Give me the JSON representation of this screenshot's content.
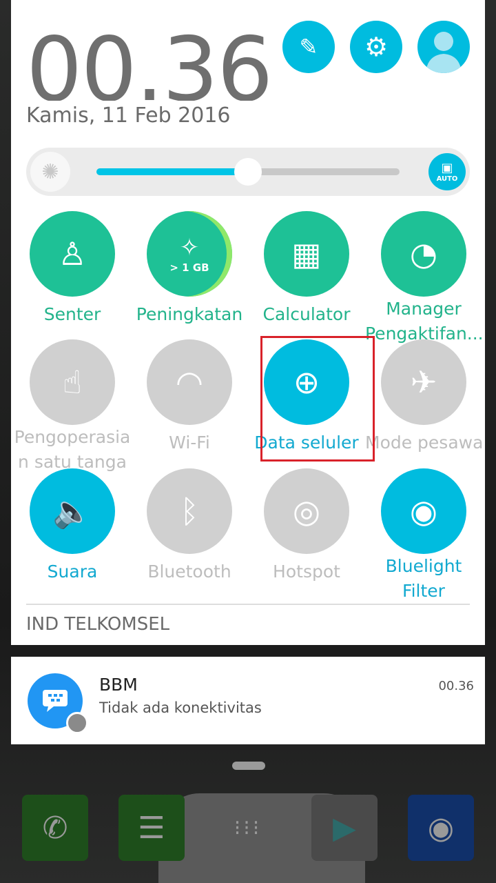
{
  "clock": {
    "time": "00.36",
    "date": "Kamis, 11 Feb 2016"
  },
  "header_buttons": [
    {
      "name": "edit-icon"
    },
    {
      "name": "gear-icon"
    },
    {
      "name": "user-avatar-icon"
    }
  ],
  "brightness": {
    "level_percent": 50,
    "auto_label": "AUTO"
  },
  "tiles": [
    {
      "label": "Senter",
      "state": "on",
      "icon": "flashlight-icon",
      "color": "#1ec196"
    },
    {
      "label": "Peningkatan",
      "badge": "> 1 GB",
      "state": "on",
      "icon": "broom-icon",
      "color": "#1ec196"
    },
    {
      "label": "Calculator",
      "state": "on",
      "icon": "calculator-icon",
      "color": "#1ec196"
    },
    {
      "label": "Manager Pengaktifan...",
      "state": "on",
      "icon": "gauge-wrench-icon",
      "color": "#1ec196"
    },
    {
      "label": "Pengoperasian satu tangan",
      "state": "off",
      "icon": "one-hand-icon",
      "color": "#d0d0d0"
    },
    {
      "label": "Wi-Fi",
      "state": "off",
      "icon": "wifi-icon",
      "color": "#d0d0d0"
    },
    {
      "label": "Data seluler",
      "state": "on",
      "icon": "globe-phone-icon",
      "color": "#00bcdf",
      "highlighted": true
    },
    {
      "label": "Mode pesawat",
      "state": "off",
      "icon": "airplane-icon",
      "color": "#d0d0d0"
    },
    {
      "label": "Suara",
      "state": "on",
      "icon": "speaker-icon",
      "color": "#00bcdf"
    },
    {
      "label": "Bluetooth",
      "state": "off",
      "icon": "bluetooth-icon",
      "color": "#d0d0d0"
    },
    {
      "label": "Hotspot",
      "state": "off",
      "icon": "hotspot-icon",
      "color": "#d0d0d0"
    },
    {
      "label": "Bluelight Filter",
      "state": "on",
      "icon": "eye-shield-icon",
      "color": "#00bcdf"
    }
  ],
  "carrier": "IND TELKOMSEL",
  "notification": {
    "app": "BBM",
    "text": "Tidak ada konektivitas",
    "time": "00.36"
  },
  "dock": [
    {
      "name": "phone-icon"
    },
    {
      "name": "messages-icon"
    },
    {
      "name": "app-drawer-icon"
    },
    {
      "name": "play-store-icon"
    },
    {
      "name": "camera-icon"
    }
  ]
}
